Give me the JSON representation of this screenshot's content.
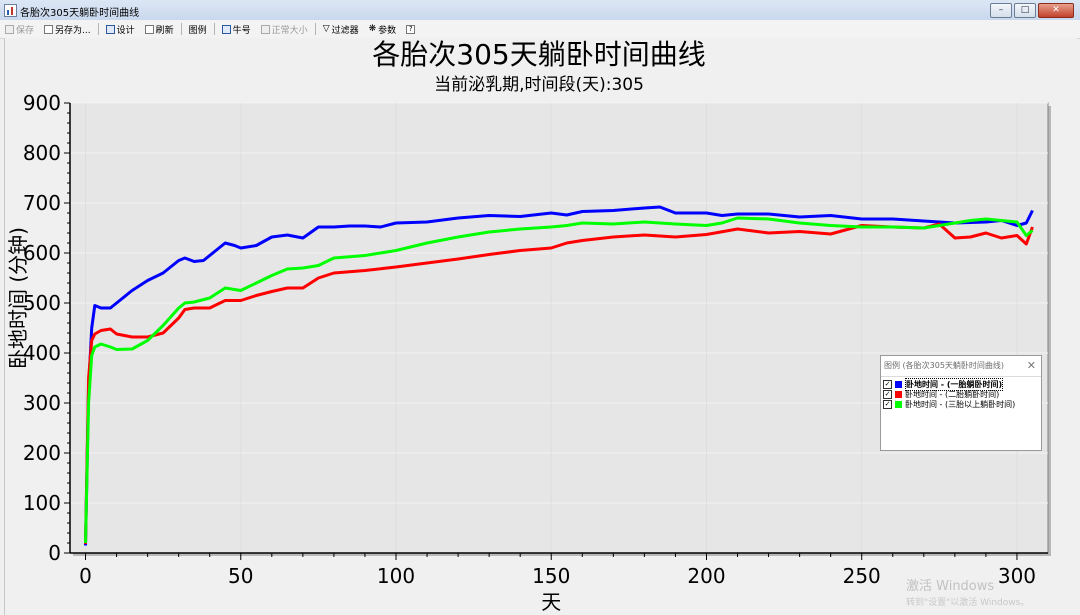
{
  "window": {
    "title": "各胎次305天躺卧时间曲线"
  },
  "toolbar": [
    {
      "label": "保存",
      "icon": "save-icon",
      "enabled": false
    },
    {
      "label": "另存为...",
      "icon": "save-as-icon",
      "enabled": true
    },
    {
      "label": "设计",
      "icon": "design-icon",
      "enabled": true
    },
    {
      "label": "刷新",
      "icon": "refresh-icon",
      "enabled": true
    },
    {
      "label": "图例",
      "icon": "legend-icon",
      "enabled": true
    },
    {
      "label": "牛号",
      "icon": "cow-id-icon",
      "enabled": true
    },
    {
      "label": "正常大小",
      "icon": "normal-size-icon",
      "enabled": false
    },
    {
      "label": "过滤器",
      "icon": "filter-icon",
      "enabled": true
    },
    {
      "label": "参数",
      "icon": "params-icon",
      "enabled": true
    },
    {
      "label": "",
      "icon": "help-icon",
      "enabled": true
    }
  ],
  "legend": {
    "title": "图例 (各胎次305天躺卧时间曲线)",
    "items": [
      {
        "label": "卧地时间 - (一胎躺卧时间)",
        "color": "#0000ff",
        "checked": true
      },
      {
        "label": "卧地时间 - (二胎躺卧时间)",
        "color": "#ff0000",
        "checked": true
      },
      {
        "label": "卧地时间 - (三胎以上躺卧时间)",
        "color": "#00ff00",
        "checked": true
      }
    ]
  },
  "watermark": {
    "line1": "激活 Windows",
    "line2": "转到\"设置\"以激活 Windows。"
  },
  "chart_data": {
    "type": "line",
    "title": "各胎次305天躺卧时间曲线",
    "subtitle": "当前泌乳期,时间段(天):305",
    "xlabel": "天",
    "ylabel": "卧地时间 (分钟)",
    "xlim": [
      -5,
      310
    ],
    "ylim": [
      0,
      900
    ],
    "xticks": [
      0,
      50,
      100,
      150,
      200,
      250,
      300
    ],
    "yticks": [
      0,
      100,
      200,
      300,
      400,
      500,
      600,
      700,
      800,
      900
    ],
    "grid": true,
    "legend_position": "right",
    "series": [
      {
        "name": "卧地时间 - (一胎躺卧时间)",
        "color": "#0000ff",
        "points": [
          [
            0,
            15
          ],
          [
            1,
            330
          ],
          [
            2,
            450
          ],
          [
            3,
            495
          ],
          [
            5,
            490
          ],
          [
            8,
            490
          ],
          [
            10,
            500
          ],
          [
            15,
            525
          ],
          [
            20,
            545
          ],
          [
            25,
            560
          ],
          [
            30,
            585
          ],
          [
            32,
            590
          ],
          [
            35,
            583
          ],
          [
            38,
            585
          ],
          [
            42,
            605
          ],
          [
            45,
            620
          ],
          [
            48,
            615
          ],
          [
            50,
            610
          ],
          [
            55,
            615
          ],
          [
            60,
            632
          ],
          [
            65,
            636
          ],
          [
            70,
            630
          ],
          [
            75,
            652
          ],
          [
            80,
            652
          ],
          [
            85,
            654
          ],
          [
            90,
            654
          ],
          [
            95,
            652
          ],
          [
            100,
            660
          ],
          [
            110,
            662
          ],
          [
            120,
            670
          ],
          [
            130,
            675
          ],
          [
            140,
            673
          ],
          [
            150,
            680
          ],
          [
            155,
            676
          ],
          [
            160,
            683
          ],
          [
            170,
            685
          ],
          [
            180,
            690
          ],
          [
            185,
            692
          ],
          [
            190,
            680
          ],
          [
            200,
            680
          ],
          [
            205,
            675
          ],
          [
            210,
            678
          ],
          [
            220,
            678
          ],
          [
            230,
            672
          ],
          [
            240,
            675
          ],
          [
            250,
            668
          ],
          [
            260,
            668
          ],
          [
            270,
            664
          ],
          [
            280,
            660
          ],
          [
            290,
            662
          ],
          [
            295,
            665
          ],
          [
            300,
            655
          ],
          [
            303,
            660
          ],
          [
            305,
            685
          ]
        ]
      },
      {
        "name": "卧地时间 - (二胎躺卧时间)",
        "color": "#ff0000",
        "points": [
          [
            0,
            18
          ],
          [
            1,
            350
          ],
          [
            2,
            425
          ],
          [
            3,
            438
          ],
          [
            5,
            445
          ],
          [
            8,
            448
          ],
          [
            10,
            438
          ],
          [
            15,
            432
          ],
          [
            20,
            432
          ],
          [
            25,
            440
          ],
          [
            30,
            470
          ],
          [
            32,
            487
          ],
          [
            35,
            490
          ],
          [
            40,
            490
          ],
          [
            45,
            505
          ],
          [
            50,
            505
          ],
          [
            55,
            515
          ],
          [
            60,
            523
          ],
          [
            65,
            530
          ],
          [
            70,
            530
          ],
          [
            75,
            550
          ],
          [
            80,
            560
          ],
          [
            90,
            565
          ],
          [
            100,
            572
          ],
          [
            110,
            580
          ],
          [
            120,
            588
          ],
          [
            130,
            597
          ],
          [
            140,
            605
          ],
          [
            150,
            610
          ],
          [
            155,
            620
          ],
          [
            160,
            625
          ],
          [
            170,
            632
          ],
          [
            180,
            636
          ],
          [
            190,
            632
          ],
          [
            200,
            637
          ],
          [
            210,
            648
          ],
          [
            220,
            640
          ],
          [
            230,
            643
          ],
          [
            240,
            638
          ],
          [
            250,
            655
          ],
          [
            260,
            652
          ],
          [
            270,
            650
          ],
          [
            275,
            658
          ],
          [
            280,
            630
          ],
          [
            285,
            632
          ],
          [
            290,
            640
          ],
          [
            295,
            630
          ],
          [
            300,
            635
          ],
          [
            303,
            618
          ],
          [
            305,
            652
          ]
        ]
      },
      {
        "name": "卧地时间 - (三胎以上躺卧时间)",
        "color": "#00ff00",
        "points": [
          [
            0,
            20
          ],
          [
            1,
            300
          ],
          [
            2,
            395
          ],
          [
            3,
            412
          ],
          [
            5,
            418
          ],
          [
            8,
            412
          ],
          [
            10,
            407
          ],
          [
            15,
            408
          ],
          [
            20,
            425
          ],
          [
            25,
            455
          ],
          [
            30,
            490
          ],
          [
            32,
            500
          ],
          [
            35,
            502
          ],
          [
            40,
            510
          ],
          [
            45,
            530
          ],
          [
            50,
            525
          ],
          [
            55,
            540
          ],
          [
            60,
            555
          ],
          [
            65,
            568
          ],
          [
            70,
            570
          ],
          [
            75,
            575
          ],
          [
            80,
            590
          ],
          [
            90,
            595
          ],
          [
            100,
            605
          ],
          [
            110,
            620
          ],
          [
            120,
            632
          ],
          [
            130,
            642
          ],
          [
            140,
            648
          ],
          [
            150,
            652
          ],
          [
            155,
            655
          ],
          [
            160,
            660
          ],
          [
            170,
            658
          ],
          [
            180,
            662
          ],
          [
            190,
            658
          ],
          [
            200,
            655
          ],
          [
            205,
            660
          ],
          [
            210,
            670
          ],
          [
            220,
            668
          ],
          [
            230,
            660
          ],
          [
            240,
            655
          ],
          [
            250,
            652
          ],
          [
            260,
            652
          ],
          [
            270,
            650
          ],
          [
            280,
            660
          ],
          [
            285,
            665
          ],
          [
            290,
            668
          ],
          [
            295,
            665
          ],
          [
            300,
            662
          ],
          [
            303,
            635
          ],
          [
            305,
            645
          ]
        ]
      }
    ]
  }
}
